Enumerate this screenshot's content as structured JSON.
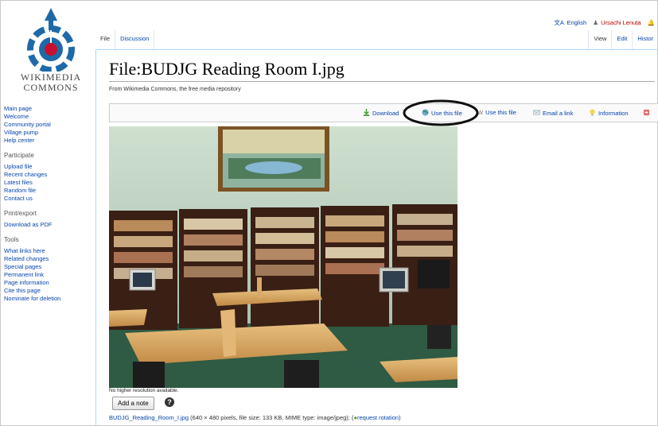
{
  "logo": {
    "word1": "WIKIMEDIA",
    "word2": "COMMONS"
  },
  "personal": {
    "language": "English",
    "username": "Ursachi Lenuța"
  },
  "tabs": {
    "file": "File",
    "discussion": "Discussion",
    "view": "View",
    "edit": "Edit",
    "history": "Histor"
  },
  "sidebar": {
    "nav": [
      "Main page",
      "Welcome",
      "Community portal",
      "Village pump",
      "Help center"
    ],
    "participate_heading": "Participate",
    "participate": [
      "Upload file",
      "Recent changes",
      "Latest files",
      "Random file",
      "Contact us"
    ],
    "print_heading": "Print/export",
    "print": [
      "Download as PDF"
    ],
    "tools_heading": "Tools",
    "tools": [
      "What links here",
      "Related changes",
      "Special pages",
      "Permanent link",
      "Page information",
      "Cite this page",
      "Nominate for deletion"
    ]
  },
  "page": {
    "title": "File:BUDJG Reading Room I.jpg",
    "tagline": "From Wikimedia Commons, the free media repository"
  },
  "toolbar": {
    "download": "Download",
    "use_on_web": "Use this file",
    "use_on_wiki": "Use this file",
    "email": "Email a link",
    "information": "Information"
  },
  "file": {
    "no_higher": "No higher resolution available.",
    "add_note": "Add a note",
    "help": "?",
    "link_name": "BUDJG_Reading_Room_I.jpg",
    "details": " (640 × 480 pixels, file size: 133 KB, MIME type: image/jpeg); (",
    "rotation": "request rotation",
    "close_paren": ")"
  },
  "colors": {
    "link": "#0645ad",
    "tab_border": "#a7d7f9",
    "highlight_ring": "#111111"
  }
}
